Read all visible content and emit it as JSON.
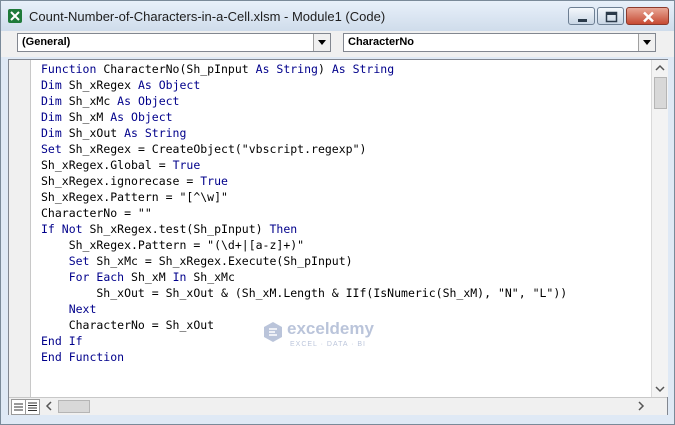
{
  "window": {
    "title": "Count-Number-of-Characters-in-a-Cell.xlsm - Module1 (Code)"
  },
  "toolbar": {
    "object_combo": "(General)",
    "procedure_combo": "CharacterNo"
  },
  "code_lines": [
    [
      {
        "t": "Function ",
        "k": true
      },
      {
        "t": "CharacterNo(Sh_pInput ",
        "k": false
      },
      {
        "t": "As String",
        "k": true
      },
      {
        "t": ") ",
        "k": false
      },
      {
        "t": "As String",
        "k": true
      }
    ],
    [
      {
        "t": "Dim ",
        "k": true
      },
      {
        "t": "Sh_xRegex ",
        "k": false
      },
      {
        "t": "As Object",
        "k": true
      }
    ],
    [
      {
        "t": "Dim ",
        "k": true
      },
      {
        "t": "Sh_xMc ",
        "k": false
      },
      {
        "t": "As Object",
        "k": true
      }
    ],
    [
      {
        "t": "Dim ",
        "k": true
      },
      {
        "t": "Sh_xM ",
        "k": false
      },
      {
        "t": "As Object",
        "k": true
      }
    ],
    [
      {
        "t": "Dim ",
        "k": true
      },
      {
        "t": "Sh_xOut ",
        "k": false
      },
      {
        "t": "As String",
        "k": true
      }
    ],
    [
      {
        "t": "Set ",
        "k": true
      },
      {
        "t": "Sh_xRegex = CreateObject(\"vbscript.regexp\")",
        "k": false
      }
    ],
    [
      {
        "t": "Sh_xRegex.Global = ",
        "k": false
      },
      {
        "t": "True",
        "k": true
      }
    ],
    [
      {
        "t": "Sh_xRegex.ignorecase = ",
        "k": false
      },
      {
        "t": "True",
        "k": true
      }
    ],
    [
      {
        "t": "Sh_xRegex.Pattern = \"[^\\w]\"",
        "k": false
      }
    ],
    [
      {
        "t": "CharacterNo = \"\"",
        "k": false
      }
    ],
    [
      {
        "t": "If Not ",
        "k": true
      },
      {
        "t": "Sh_xRegex.test(Sh_pInput) ",
        "k": false
      },
      {
        "t": "Then",
        "k": true
      }
    ],
    [
      {
        "t": "    Sh_xRegex.Pattern = \"(\\d+|[a-z]+)\"",
        "k": false
      }
    ],
    [
      {
        "t": "    ",
        "k": false
      },
      {
        "t": "Set ",
        "k": true
      },
      {
        "t": "Sh_xMc = Sh_xRegex.Execute(Sh_pInput)",
        "k": false
      }
    ],
    [
      {
        "t": "    ",
        "k": false
      },
      {
        "t": "For Each ",
        "k": true
      },
      {
        "t": "Sh_xM ",
        "k": false
      },
      {
        "t": "In ",
        "k": true
      },
      {
        "t": "Sh_xMc",
        "k": false
      }
    ],
    [
      {
        "t": "        Sh_xOut = Sh_xOut & (Sh_xM.Length & IIf(IsNumeric(Sh_xM), \"N\", \"L\"))",
        "k": false
      }
    ],
    [
      {
        "t": "    ",
        "k": false
      },
      {
        "t": "Next",
        "k": true
      }
    ],
    [
      {
        "t": "    CharacterNo = Sh_xOut",
        "k": false
      }
    ],
    [
      {
        "t": "End If",
        "k": true
      }
    ],
    [
      {
        "t": "End Function",
        "k": true
      }
    ]
  ],
  "watermark": {
    "name": "exceldemy",
    "tagline": "EXCEL · DATA · BI"
  },
  "colors": {
    "keyword": "#00008b",
    "text": "#000000"
  }
}
